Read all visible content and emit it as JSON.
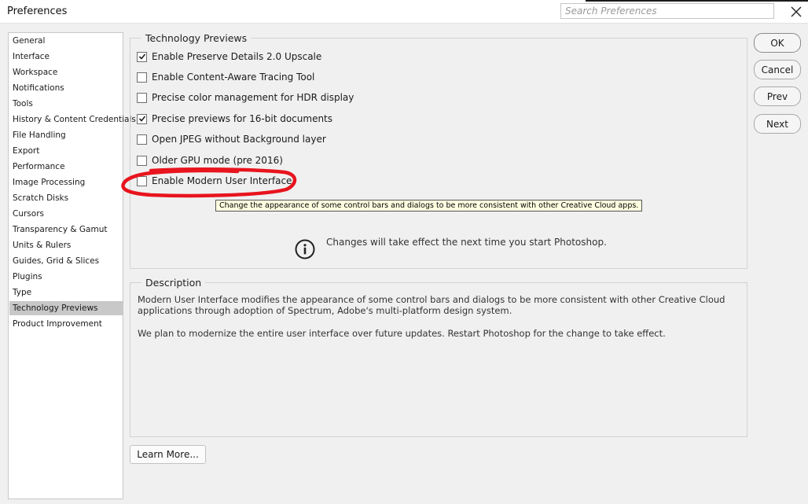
{
  "window": {
    "title": "Preferences",
    "search_placeholder": "Search Preferences"
  },
  "sidebar": {
    "items": [
      {
        "label": "General"
      },
      {
        "label": "Interface"
      },
      {
        "label": "Workspace"
      },
      {
        "label": "Notifications"
      },
      {
        "label": "Tools"
      },
      {
        "label": "History & Content Credentials"
      },
      {
        "label": "File Handling"
      },
      {
        "label": "Export"
      },
      {
        "label": "Performance"
      },
      {
        "label": "Image Processing"
      },
      {
        "label": "Scratch Disks"
      },
      {
        "label": "Cursors"
      },
      {
        "label": "Transparency & Gamut"
      },
      {
        "label": "Units & Rulers"
      },
      {
        "label": "Guides, Grid & Slices"
      },
      {
        "label": "Plugins"
      },
      {
        "label": "Type"
      },
      {
        "label": "Technology Previews",
        "selected": true
      },
      {
        "label": "Product Improvement"
      }
    ]
  },
  "tech_previews": {
    "legend": "Technology Previews",
    "options": [
      {
        "label": "Enable Preserve Details 2.0 Upscale",
        "checked": true
      },
      {
        "label": "Enable Content-Aware Tracing Tool",
        "checked": false
      },
      {
        "label": "Precise color management for HDR display",
        "checked": false
      },
      {
        "label": "Precise previews for 16-bit documents",
        "checked": true
      },
      {
        "label": "Open JPEG without Background layer",
        "checked": false
      },
      {
        "label": "Older GPU mode (pre 2016)",
        "checked": false
      },
      {
        "label": "Enable Modern User Interface",
        "checked": false
      }
    ],
    "tooltip": "Change the appearance of some control bars and dialogs to be more consistent with other Creative Cloud apps.",
    "info_text": "Changes will take effect the next time you start Photoshop."
  },
  "description": {
    "legend": "Description",
    "paragraph1": "Modern User Interface modifies the appearance of some control bars and dialogs to be more consistent with other Creative Cloud applications through adoption of Spectrum, Adobe's multi-platform design system.",
    "paragraph2": "We plan to modernize the entire user interface over future updates. Restart Photoshop for the change to take effect."
  },
  "buttons": {
    "ok": "OK",
    "cancel": "Cancel",
    "prev": "Prev",
    "next": "Next",
    "learn_more": "Learn More..."
  },
  "colors": {
    "annotation_red": "#e8141e",
    "selected_item": "#c8c8c8",
    "tooltip_bg": "#ffffe1"
  }
}
